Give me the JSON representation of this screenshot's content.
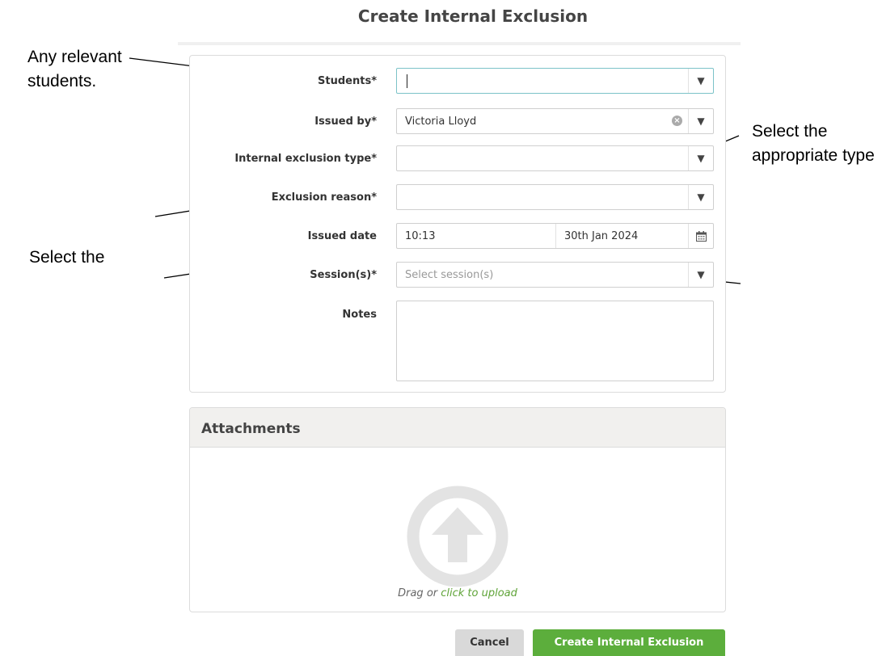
{
  "title": "Create Internal Exclusion",
  "annotations": {
    "students_note": "Any relevant students.",
    "type_note": "Select the appropriate type",
    "date_note": "Select the"
  },
  "form": {
    "students_label": "Students*",
    "students_value": "",
    "issued_by_label": "Issued by*",
    "issued_by_value": "Victoria Lloyd",
    "exclusion_type_label": "Internal exclusion type*",
    "exclusion_type_value": "",
    "exclusion_reason_label": "Exclusion reason*",
    "exclusion_reason_value": "",
    "issued_date_label": "Issued date",
    "issued_time": "10:13",
    "issued_date": "30th Jan 2024",
    "sessions_label": "Session(s)*",
    "sessions_placeholder": "Select session(s)",
    "notes_label": "Notes",
    "notes_value": ""
  },
  "attachments": {
    "header": "Attachments",
    "drag_text": "Drag or ",
    "upload_link": "click to upload"
  },
  "buttons": {
    "cancel": "Cancel",
    "create": "Create Internal Exclusion"
  },
  "icons": {
    "dropdown": "chevron-down-icon",
    "clear": "clear-icon",
    "calendar": "calendar-icon",
    "upload": "upload-arrow-icon"
  },
  "colors": {
    "accent_green": "#5cae3c",
    "link_green": "#5ea337",
    "focus_border": "#7cc3c8"
  }
}
